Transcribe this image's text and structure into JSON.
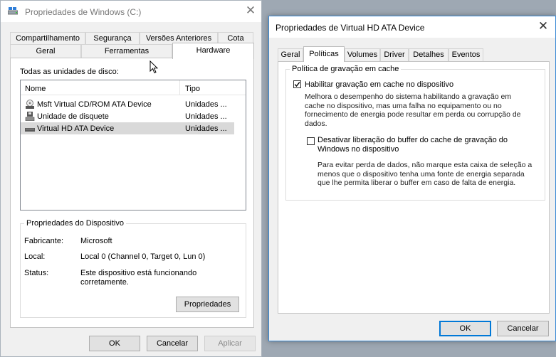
{
  "win1": {
    "title": "Propriedades de Windows (C:)",
    "close_glyph": "✕",
    "tabs_row1": [
      "Compartilhamento",
      "Segurança",
      "Versões Anteriores",
      "Cota"
    ],
    "tabs_row2": [
      "Geral",
      "Ferramentas",
      "Hardware"
    ],
    "active_tab": "Hardware",
    "disks_label": "Todas as unidades de disco:",
    "columns": {
      "name": "Nome",
      "type": "Tipo"
    },
    "disks": [
      {
        "name": "Msft Virtual CD/ROM ATA Device",
        "type": "Unidades ...",
        "icon": "cd-drive-icon"
      },
      {
        "name": "Unidade de disquete",
        "type": "Unidades ...",
        "icon": "floppy-drive-icon"
      },
      {
        "name": "Virtual HD ATA Device",
        "type": "Unidades ...",
        "icon": "hard-drive-icon",
        "selected": true
      }
    ],
    "device_props": {
      "title": "Propriedades do Dispositivo",
      "manufacturer_label": "Fabricante:",
      "manufacturer": "Microsoft",
      "location_label": "Local:",
      "location": "Local 0 (Channel 0, Target 0, Lun 0)",
      "status_label": "Status:",
      "status_line1": "Este dispositivo está funcionando",
      "status_line2": "corretamente.",
      "properties_button": "Propriedades"
    },
    "buttons": {
      "ok": "OK",
      "cancel": "Cancelar",
      "apply": "Aplicar"
    }
  },
  "win2": {
    "title": "Propriedades de Virtual HD ATA Device",
    "close_glyph": "✕",
    "tabs": [
      "Geral",
      "Políticas",
      "Volumes",
      "Driver",
      "Detalhes",
      "Eventos"
    ],
    "active_tab": "Políticas",
    "policy_group": "Política de gravação em cache",
    "enable_cache": {
      "checked": true,
      "label": "Habilitar gravação em cache no dispositivo",
      "desc": [
        "Melhora o desempenho do sistema habilitando a gravação em",
        "cache no dispositivo, mas uma falha no equipamento ou no",
        "fornecimento de energia pode resultar em perda ou corrupção de",
        "dados."
      ]
    },
    "disable_flush": {
      "checked": false,
      "label_line1": "Desativar liberação do buffer do cache de gravação do",
      "label_line2": "Windows no dispositivo",
      "desc": [
        "Para evitar perda de dados, não marque esta caixa de seleção a",
        "menos que o dispositivo tenha uma fonte de energia separada",
        "que lhe permita liberar o buffer em caso de falta de energia."
      ]
    },
    "buttons": {
      "ok": "OK",
      "cancel": "Cancelar"
    }
  },
  "colors": {
    "accent": "#0078d7",
    "selected_row": "#d9d9d9"
  }
}
